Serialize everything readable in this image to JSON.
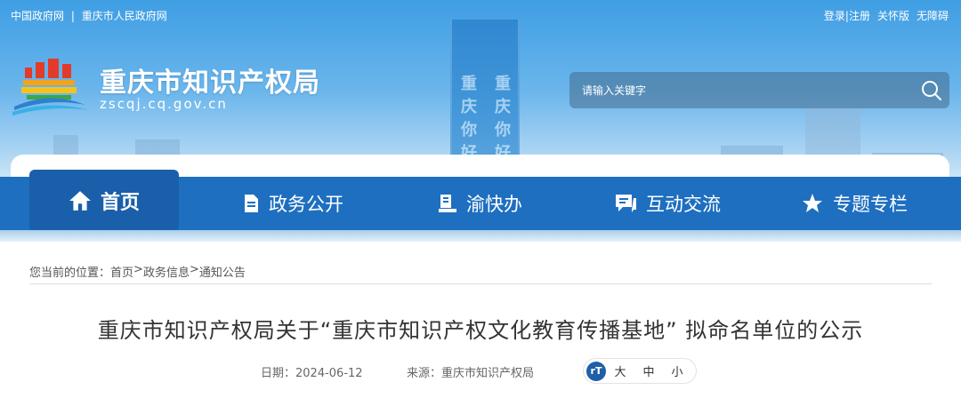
{
  "topbar": {
    "links_left": [
      "中国政府网",
      "|",
      "重庆市人民政府网"
    ],
    "login_register": "登录|注册",
    "care_version": "关怀版",
    "accessibility": "无障碍"
  },
  "site": {
    "title": "重庆市知识产权局",
    "domain": "zscqj.cq.gov.cn",
    "tower_left": "重庆你好",
    "tower_right": "重庆你好"
  },
  "search": {
    "placeholder": "请输入关键字"
  },
  "nav": {
    "items": [
      {
        "label": "首页",
        "icon": "home-icon"
      },
      {
        "label": "政务公开",
        "icon": "document-icon"
      },
      {
        "label": "渝快办",
        "icon": "service-icon"
      },
      {
        "label": "互动交流",
        "icon": "chat-icon"
      },
      {
        "label": "专题专栏",
        "icon": "star-icon"
      }
    ]
  },
  "breadcrumb": {
    "prefix": "您当前的位置：",
    "items": [
      "首页",
      "政务信息",
      "通知公告"
    ],
    "separator": ">"
  },
  "article": {
    "title": "重庆市知识产权局关于“重庆市知识产权文化教育传播基地” 拟命名单位的公示",
    "date_label": "日期：",
    "date": "2024-06-12",
    "source_label": "来源：",
    "source": "重庆市知识产权局",
    "fontsize_icon": "rT",
    "fontsize_options": [
      "大",
      "中",
      "小"
    ]
  },
  "colors": {
    "nav_bg": "#1e6fc0",
    "nav_active_bg": "#1a5faa",
    "title_text": "#333333"
  }
}
